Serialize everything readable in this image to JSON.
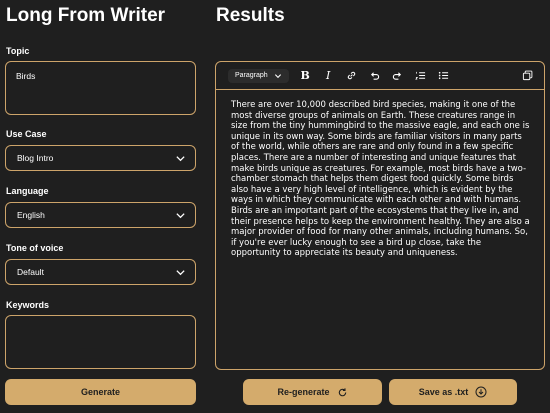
{
  "left": {
    "app_title": "Long From Writer",
    "topic": {
      "label": "Topic",
      "value": "Birds"
    },
    "use_case": {
      "label": "Use Case",
      "value": "Blog Intro"
    },
    "language": {
      "label": "Language",
      "value": "English"
    },
    "tone": {
      "label": "Tone of voice",
      "value": "Default"
    },
    "keywords": {
      "label": "Keywords",
      "value": ""
    },
    "generate_label": "Generate"
  },
  "results": {
    "title": "Results",
    "toolbar": {
      "format_value": "Paragraph",
      "icons": [
        "bold-icon",
        "italic-icon",
        "link-icon",
        "undo-icon",
        "redo-icon",
        "ordered-list-icon",
        "bullet-list-icon",
        "copy-icon"
      ]
    },
    "content": "There are over 10,000 described bird species, making it one of the most diverse groups of animals on Earth. These creatures range in size from the tiny hummingbird to the massive eagle, and each one is unique in its own way. Some birds are familiar visitors in many parts of the world, while others are rare and only found in a few specific places. There are a number of interesting and unique features that make birds unique as creatures. For example, most birds have a two-chamber stomach that helps them digest food quickly. Some birds also have a very high level of intelligence, which is evident by the ways in which they communicate with each other and with humans. Birds are an important part of the ecosystems that they live in, and their presence helps to keep the environment healthy. They are also a major provider of food for many other animals, including humans. So, if you're ever lucky enough to see a bird up close, take the opportunity to appreciate its beauty and uniqueness.",
    "regenerate_label": "Re-generate",
    "save_label": "Save as .txt"
  },
  "colors": {
    "background": "#1f1f1f",
    "accent": "#d4ab6c",
    "border": "#cda46a",
    "text": "#ffffff"
  }
}
